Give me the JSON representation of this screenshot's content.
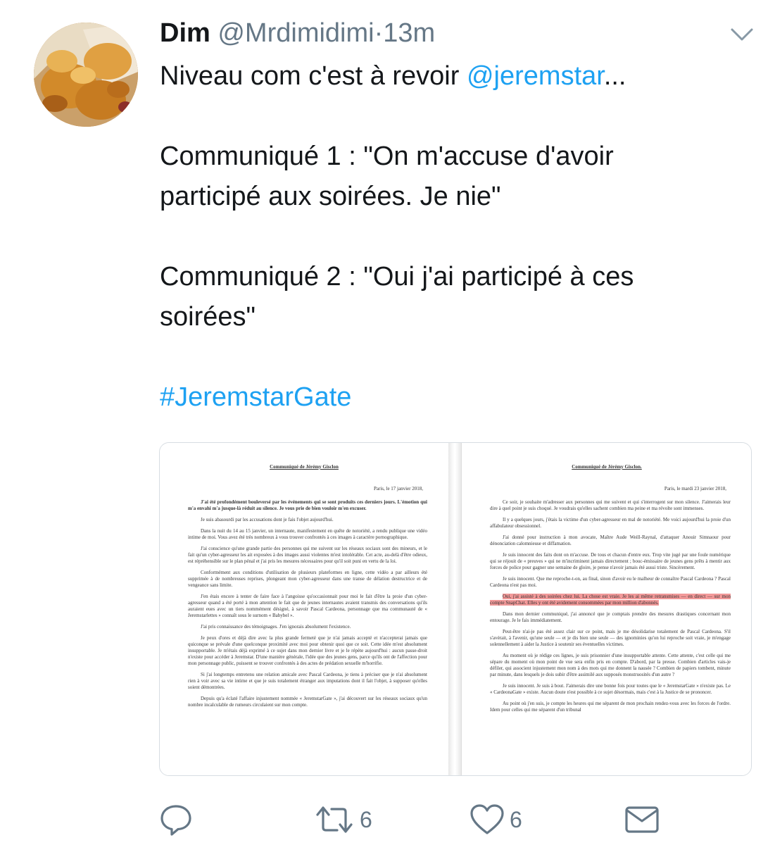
{
  "tweet": {
    "author_name": "Dim",
    "handle": "@Mrdimidimi",
    "separator": "·",
    "time": "13m",
    "lines": {
      "l1_text": "Niveau com c'est à revoir ",
      "l1_mention": "@jeremstar",
      "l1_ellipsis": "...",
      "l2": "Communiqué 1 : \"On m'accuse d'avoir",
      "l3": "participé aux soirées. Je nie\"",
      "l4": "Communiqué 2 : \"Oui j'ai participé à ces",
      "l5": "soirées\"",
      "hashtag": "#JeremstarGate"
    }
  },
  "document": {
    "left": {
      "title": "Communiqué de Jérémy Gisclon",
      "date": "Paris, le 17 janvier 2018,",
      "paragraphs": [
        "J'ai été profondément bouleversé par les événements qui se sont produits ces derniers jours. L'émotion qui m'a envahi m'a jusque-là réduit au silence. Je vous prie de bien vouloir m'en excuser.",
        "Je suis abasourdi par les accusations dont je fais l'objet aujourd'hui.",
        "Dans la nuit du 14 au 15 janvier, un internaute, manifestement en quête de notoriété, a rendu publique une vidéo intime de moi. Vous avez été très nombreux à vous trouver confrontés à ces images à caractère pornographique.",
        "J'ai conscience qu'une grande partie des personnes qui me suivent sur les réseaux sociaux sont des mineurs, et le fait qu'un cyber-agresseur les ait exposées à des images aussi violentes m'est intolérable. Cet acte, au-delà d'être odieux, est répréhensible sur le plan pénal et j'ai pris les mesures nécessaires pour qu'il soit puni en vertu de la loi.",
        "Conformément aux conditions d'utilisation de plusieurs plateformes en ligne, cette vidéo a par ailleurs été supprimée à de nombreuses reprises, plongeant mon cyber-agresseur dans une transe de délation destructrice et de vengeance sans limite.",
        "J'en étais encore à tenter de faire face à l'angoisse qu'occasionnait pour moi le fait d'être la proie d'un cyber-agresseur quand a été porté à mon attention le fait que de jeunes internautes avaient transmis des conversations qu'ils auraient eues avec un tiers nommément désigné, à savoir Pascal Cardeona, personnage que ma communauté de « Jeremstarlettes » connaît sous le surnom « Babybel ».",
        "J'ai pris connaissance des témoignages. J'en ignorais absolument l'existence.",
        "Je peux d'ores et déjà dire avec la plus grande fermeté que je n'ai jamais accepté et n'accepterai jamais que quiconque se prévale d'une quelconque proximité avec moi pour obtenir quoi que ce soit. Cette idée m'est absolument insupportable. Je m'étais déjà exprimé à ce sujet dans mon dernier livre et je le répète aujourd'hui : aucun passe-droit n'existe pour accéder à Jeremstar. D'une manière générale, l'idée que des jeunes gens, parce qu'ils ont de l'affection pour mon personnage public, puissent se trouver confrontés à des actes de prédation sexuelle m'horrifie.",
        "Si j'ai longtemps entretenu une relation amicale avec Pascal Cardeona, je tiens à préciser que je n'ai absolument rien à voir avec sa vie intime et que je suis totalement étranger aux imputations dont il fait l'objet, à supposer qu'elles soient démontrées.",
        "Depuis qu'a éclaté l'affaire injustement nommée « JeremstarGate », j'ai découvert sur les réseaux sociaux qu'un nombre incalculable de rumeurs circulaient sur mon compte."
      ]
    },
    "right": {
      "title": "Communiqué de Jérémy Gisclon.",
      "date": "Paris, le mardi 23 janvier 2018,",
      "paragraphs": [
        "Ce soir, je souhaite m'adresser aux personnes qui me suivent et qui s'interrogent sur mon silence. J'aimerais leur dire à quel point je suis choqué. Je voudrais qu'elles sachent combien ma peine et ma révolte sont immenses.",
        "Il y a quelques jours, j'étais la victime d'un cyber-agresseur en mal de notoriété. Me voici aujourd'hui la proie d'un affabulateur obsessionnel.",
        "J'ai donné pour instruction à mon avocate, Maître Aude Weill-Raynal, d'attaquer Anouir Simnaour pour dénonciation calomnieuse et diffamation.",
        "Je suis innocent des faits dont on m'accuse. De tous et chacun d'entre eux. Trop vite jugé par une foule numérique qui se réjouit de « preuves » qui ne m'incriminent jamais directement ; bouc-émissaire de jeunes gens prêts à mentir aux forces de police pour gagner une semaine de gloire, je pense n'avoir jamais été aussi triste. Sincèrement.",
        "Je suis innocent. Que me reproche-t-on, au final, sinon d'avoir eu le malheur de connaître Pascal Cardeona ? Pascal Cardeona n'est pas moi.",
        "Oui, j'ai assisté à des soirées chez lui. La chose est vraie. Je les ai même retransmises — en direct — sur mon compte SnapChat. Elles y ont été avidement consommées par mon million d'abonnés.",
        "Dans mon dernier communiqué, j'ai annoncé que je comptais prendre des mesures drastiques concernant mon entourage. Je le fais immédiatement.",
        "Peut-être n'ai-je pas été assez clair sur ce point, mais je me désolidarise totalement de Pascal Cardeona. S'il s'avérait, à l'avenir, qu'une seule — et je dis bien une seule — des ignominies qu'on lui reproche soit vraie, je m'engage solennellement à aider la Justice à soutenir ses éventuelles victimes.",
        "Au moment où je rédige ces lignes, je suis prisonnier d'une insupportable attente. Cette attente, c'est celle qui me sépare du moment où mon point de vue sera enfin pris en compte. D'abord, par la presse. Combien d'articles vais-je défiler, qui associent injustement mon nom à des mots qui me donnent la nausée ? Combien de papiers tombent, minute par minute, dans lesquels je dois subir d'être assimilé aux supposés monstruosités d'un autre ?",
        "Je suis innocent. Je suis à bout. J'aimerais dire une bonne fois pour toutes que le « JeremstarGate » n'existe pas. Le « CardeonaGate » existe. Aucun doute n'est possible à ce sujet désormais, mais c'est à la Justice de se prononcer.",
        "Au point où j'en suis, je compte les heures qui me séparent de mon prochain rendez-vous avec les forces de l'ordre. Idem pour celles qui me séparent d'un tribunal"
      ]
    }
  },
  "actions": {
    "reply_icon": "reply-icon",
    "retweet_icon": "retweet-icon",
    "retweet_count": "6",
    "like_icon": "heart-icon",
    "like_count": "6",
    "dm_icon": "envelope-icon",
    "icon_color": "#657786"
  },
  "colors": {
    "link": "#1da1f2",
    "text": "#14171a",
    "muted": "#657786"
  }
}
